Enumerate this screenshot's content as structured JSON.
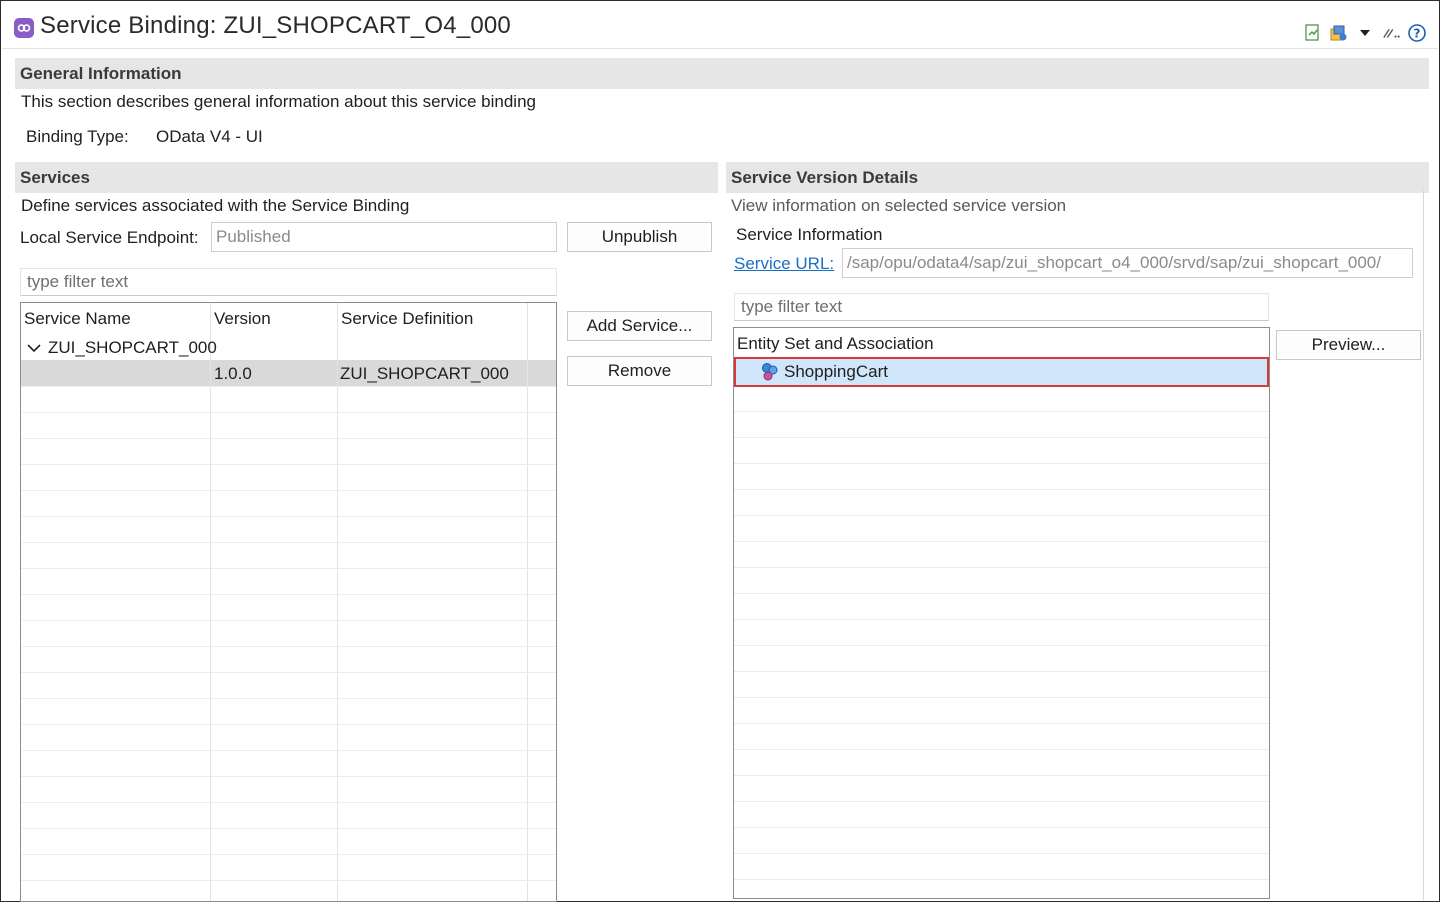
{
  "header": {
    "title": "Service Binding: ZUI_SHOPCART_O4_000",
    "icon": "service-binding-icon",
    "toolbar_icons": [
      "export-icon",
      "settings-icon",
      "dropdown-arrow-icon",
      "link-icon",
      "help-icon"
    ]
  },
  "general": {
    "title": "General Information",
    "description": "This section describes general information about this service binding",
    "binding_type_label": "Binding Type:",
    "binding_type_value": "OData V4 - UI"
  },
  "services": {
    "title": "Services",
    "description": "Define services associated with the Service Binding",
    "endpoint_label": "Local Service Endpoint:",
    "endpoint_value": "Published",
    "unpublish_label": "Unpublish",
    "filter_placeholder": "type filter text",
    "add_service_label": "Add Service...",
    "remove_label": "Remove",
    "columns": [
      "Service Name",
      "Version",
      "Service Definition"
    ],
    "tree": {
      "service_name": "ZUI_SHOPCART_000",
      "version": "1.0.0",
      "service_definition": "ZUI_SHOPCART_000"
    }
  },
  "details": {
    "title": "Service Version Details",
    "description": "View information on selected service version",
    "info_title": "Service Information",
    "url_label": "Service URL:",
    "url_value": "/sap/opu/odata4/sap/zui_shopcart_o4_000/srvd/sap/zui_shopcart_000/",
    "filter_placeholder": "type filter text",
    "entity_header": "Entity Set and Association",
    "entities": [
      "ShoppingCart"
    ],
    "preview_label": "Preview..."
  },
  "colors": {
    "header_bg": "#e6e6e6",
    "selection_bg": "#cfe6fb",
    "highlight_border": "#d9383a",
    "link": "#1a6fc2"
  }
}
